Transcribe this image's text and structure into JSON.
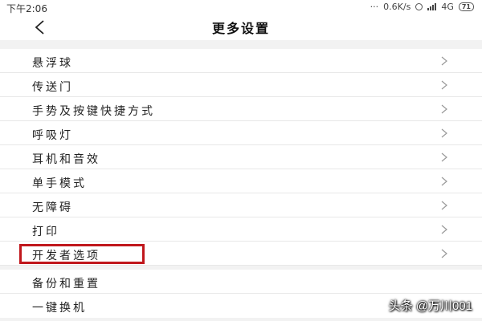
{
  "status_bar": {
    "time": "下午2:06",
    "network_speed": "0.6K/s",
    "network_type": "4G",
    "battery": "71"
  },
  "header": {
    "back_icon": "chevron-left-icon",
    "title": "更多设置"
  },
  "settings": {
    "items": [
      {
        "label": "悬浮球",
        "icon": "chevron-right-icon"
      },
      {
        "label": "传送门",
        "icon": "chevron-right-icon"
      },
      {
        "label": "手势及按键快捷方式",
        "icon": "chevron-right-icon"
      },
      {
        "label": "呼吸灯",
        "icon": "chevron-right-icon"
      },
      {
        "label": "耳机和音效",
        "icon": "chevron-right-icon"
      },
      {
        "label": "单手模式",
        "icon": "chevron-right-icon"
      },
      {
        "label": "无障碍",
        "icon": "chevron-right-icon"
      },
      {
        "label": "打印",
        "icon": "chevron-right-icon"
      },
      {
        "label": "开发者选项",
        "icon": "chevron-right-icon",
        "highlighted": true
      }
    ],
    "items2": [
      {
        "label": "备份和重置"
      },
      {
        "label": "一键换机"
      }
    ]
  },
  "highlight_color": "#c0171c",
  "watermark": "头条 @万川001"
}
